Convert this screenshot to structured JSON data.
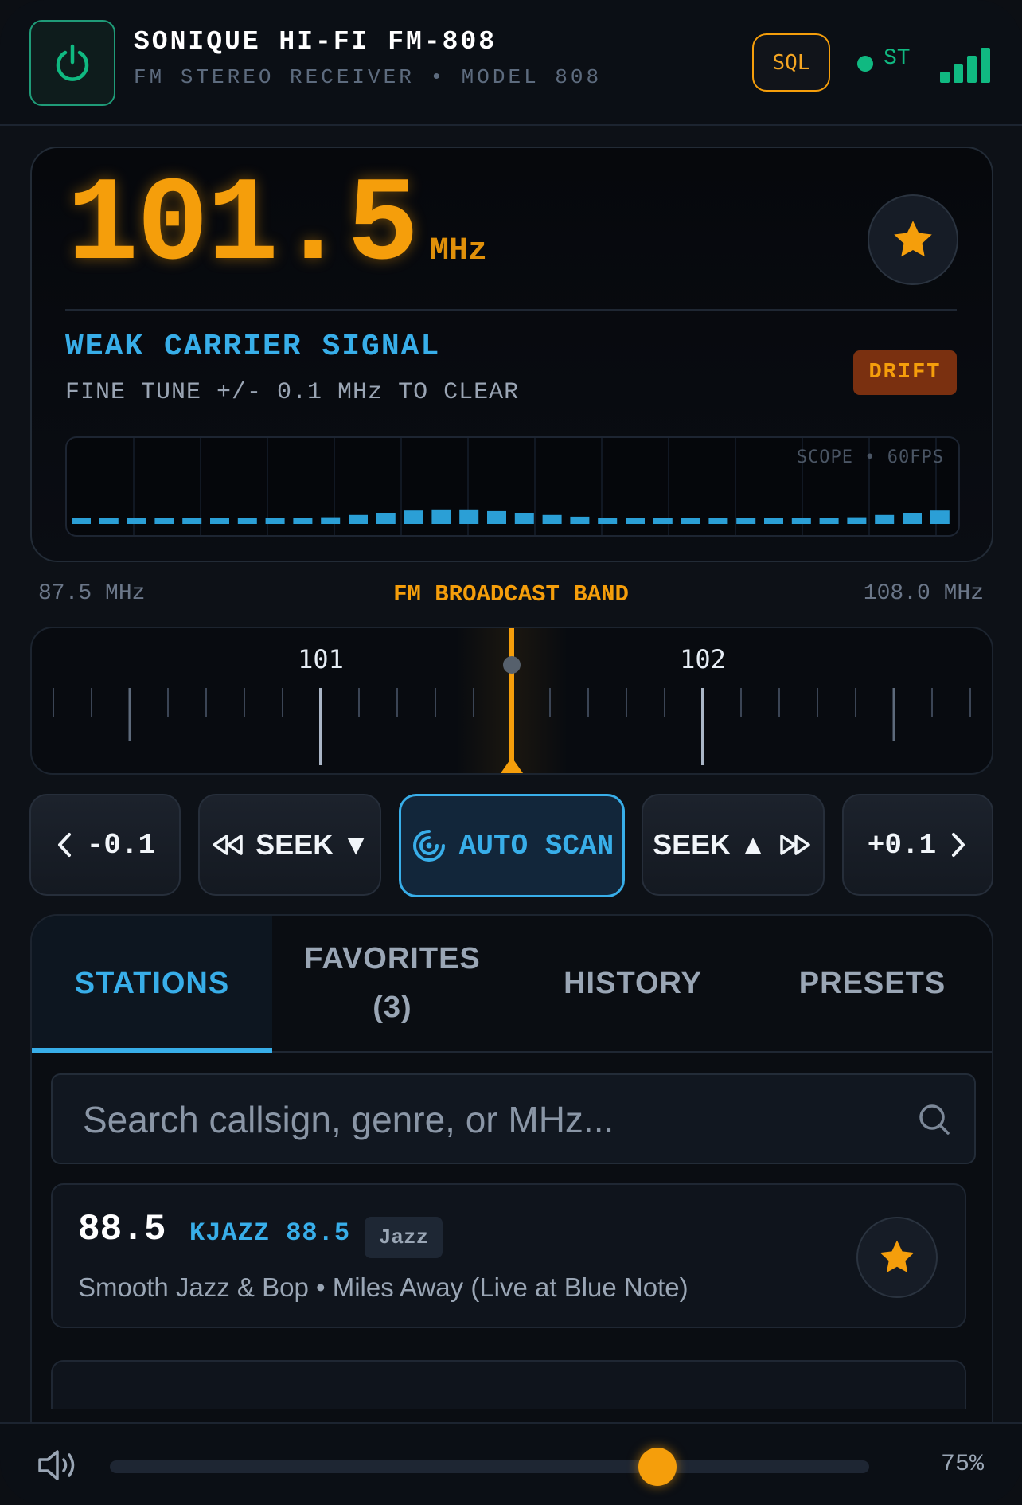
{
  "header": {
    "title": "SONIQUE HI-FI FM-808",
    "subtitle": "FM STEREO RECEIVER • MODEL 808",
    "sql_label": "SQL",
    "stereo_label": "ST",
    "signal_bars": 4
  },
  "display": {
    "frequency": "101.5",
    "unit": "MHz",
    "status_title": "WEAK CARRIER SIGNAL",
    "status_sub": "FINE TUNE +/- 0.1 MHz TO CLEAR",
    "badge": "DRIFT",
    "scope_label": "SCOPE • 60FPS",
    "scope_levels": [
      1,
      1,
      1,
      1,
      1,
      1,
      1,
      1,
      1,
      1.2,
      1.6,
      2,
      2.4,
      2.6,
      2.6,
      2.3,
      2,
      1.6,
      1.3,
      1,
      1,
      1,
      1,
      1,
      1,
      1,
      1,
      1,
      1.2,
      1.6,
      2,
      2.4,
      2.6
    ]
  },
  "band": {
    "min_label": "87.5 MHz",
    "name": "FM BROADCAST BAND",
    "max_label": "108.0 MHz"
  },
  "dial": {
    "labels": [
      "101",
      "102"
    ],
    "needle_value": 101.5
  },
  "controls": {
    "fine_down": "-0.1",
    "seek_down": "SEEK ▼",
    "scan": "AUTO SCAN",
    "seek_up": "SEEK ▲",
    "fine_up": "+0.1"
  },
  "tabs": [
    {
      "label": "STATIONS"
    },
    {
      "label": "FAVORITES",
      "count": "(3)"
    },
    {
      "label": "HISTORY"
    },
    {
      "label": "PRESETS"
    }
  ],
  "search": {
    "placeholder": "Search callsign, genre, or MHz..."
  },
  "stations": [
    {
      "freq": "88.5",
      "callsign": "KJAZZ 88.5",
      "genre": "Jazz",
      "description": "Smooth Jazz & Bop • Miles Away (Live at Blue Note)",
      "favorite": true
    }
  ],
  "volume": {
    "percent_label": "75%",
    "level": 0.75
  },
  "colors": {
    "accent": "#f59e0b",
    "info": "#38aee9",
    "ok": "#10b981"
  }
}
